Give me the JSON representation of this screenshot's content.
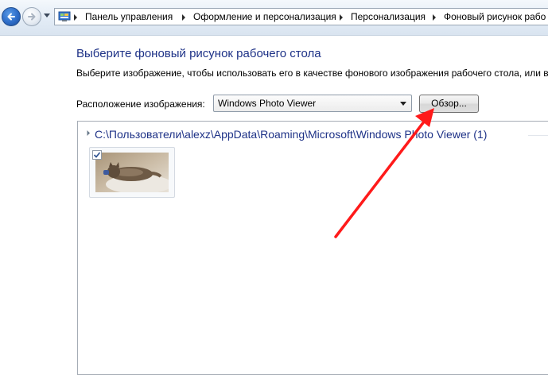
{
  "nav": {
    "back_icon": "back-arrow-icon",
    "forward_icon": "forward-arrow-icon",
    "history_icon": "chevron-down-icon"
  },
  "breadcrumb": {
    "icon": "control-panel-icon",
    "items": [
      "Панель управления",
      "Оформление и персонализация",
      "Персонализация",
      "Фоновый рисунок рабо"
    ]
  },
  "main": {
    "title": "Выберите фоновый рисунок рабочего стола",
    "subtitle": "Выберите изображение, чтобы использовать его в качестве фонового изображения рабочего стола, или в",
    "location_label": "Расположение изображения:",
    "location_value": "Windows Photo Viewer",
    "browse_label": "Обзор..."
  },
  "gallery": {
    "group_header": "C:\\Пользователи\\alexz\\AppData\\Roaming\\Microsoft\\Windows Photo Viewer (1)",
    "items": [
      {
        "name": "kitten-thumbnail",
        "checked": true
      }
    ]
  },
  "colors": {
    "title_blue": "#1e3287",
    "annotation_red": "#ff1a1a"
  }
}
